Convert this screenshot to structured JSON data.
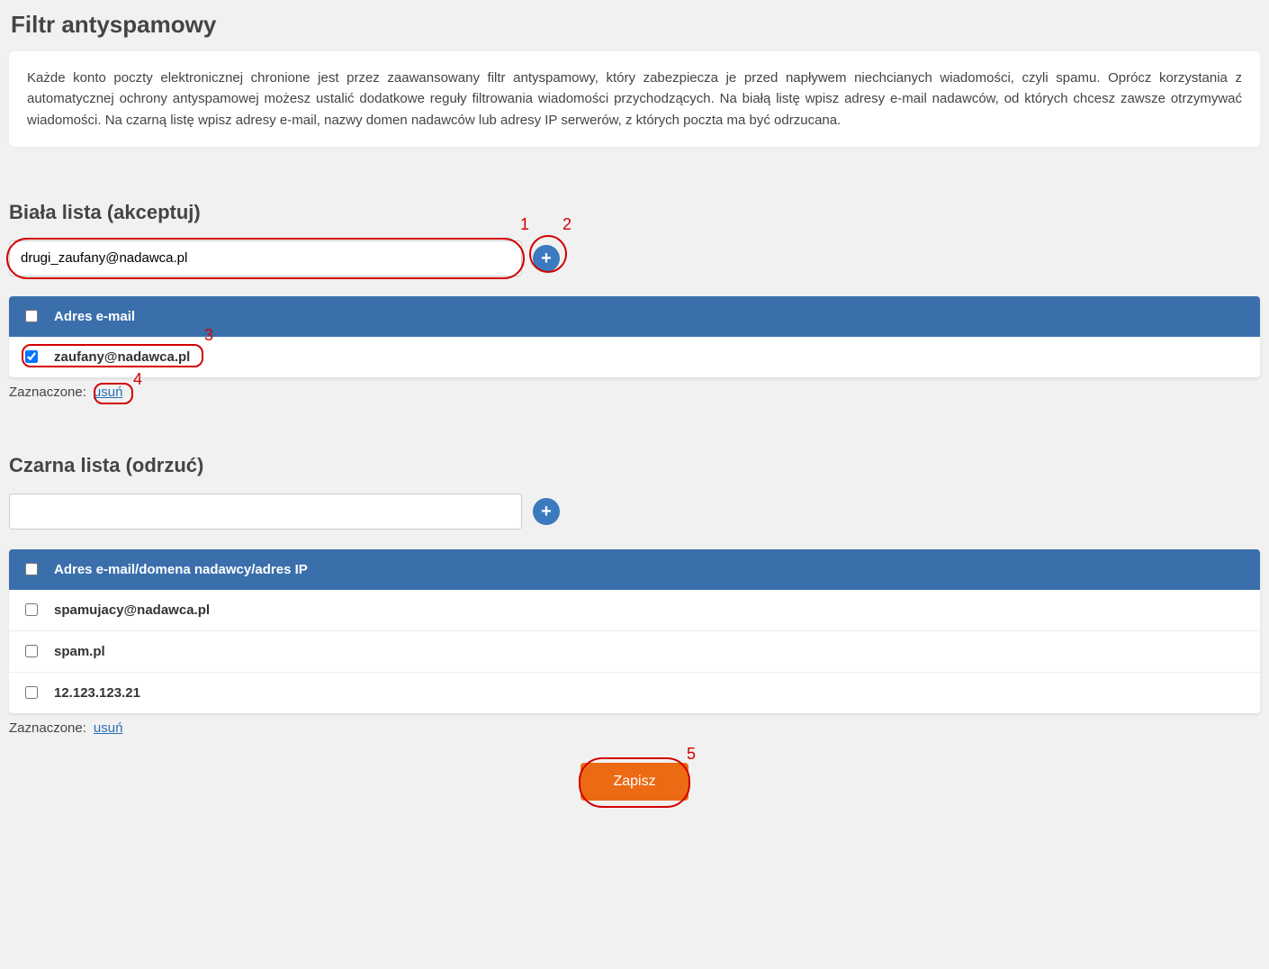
{
  "page_title": "Filtr antyspamowy",
  "description": "Każde konto poczty elektronicznej chronione jest przez zaawansowany filtr antyspamowy, który zabezpiecza je przed napływem niechcianych wiadomości, czyli spamu. Oprócz korzystania z automatycznej ochrony antyspamowej możesz ustalić dodatkowe reguły filtrowania wiadomości przychodzących. Na białą listę wpisz adresy e-mail nadawców, od których chcesz zawsze otrzymywać wiadomości. Na czarną listę wpisz adresy e-mail, nazwy domen nadawców lub adresy IP serwerów, z których poczta ma być odrzucana.",
  "whitelist": {
    "title": "Biała lista (akceptuj)",
    "input_value": "drugi_zaufany@nadawca.pl",
    "header_label": "Adres e-mail",
    "items": [
      {
        "value": "zaufany@nadawca.pl",
        "checked": true
      }
    ],
    "selected_label": "Zaznaczone:",
    "delete_label": "usuń"
  },
  "blacklist": {
    "title": "Czarna lista (odrzuć)",
    "input_value": "",
    "header_label": "Adres e-mail/domena nadawcy/adres IP",
    "items": [
      {
        "value": "spamujacy@nadawca.pl",
        "checked": false
      },
      {
        "value": "spam.pl",
        "checked": false
      },
      {
        "value": "12.123.123.21",
        "checked": false
      }
    ],
    "selected_label": "Zaznaczone:",
    "delete_label": "usuń"
  },
  "save_label": "Zapisz",
  "annotations": {
    "n1": "1",
    "n2": "2",
    "n3": "3",
    "n4": "4",
    "n5": "5"
  }
}
